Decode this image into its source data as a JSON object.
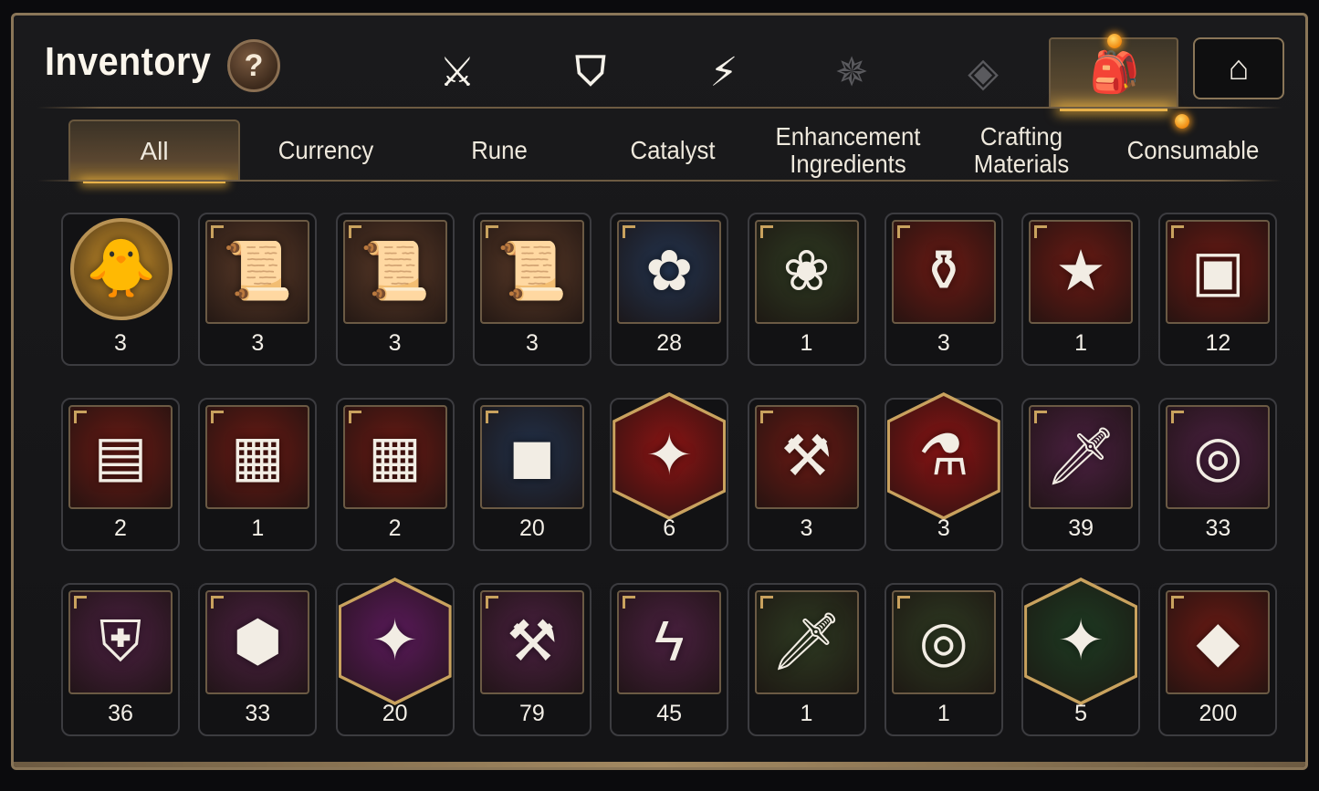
{
  "header": {
    "title": "Inventory",
    "help_label": "?"
  },
  "category_icons": [
    {
      "name": "equipment-icon",
      "glyph": "⚔"
    },
    {
      "name": "broken-shield-icon",
      "glyph": "⛉"
    },
    {
      "name": "lightning-icon",
      "glyph": "⚡"
    },
    {
      "name": "rune-burst-icon",
      "glyph": "✵"
    },
    {
      "name": "cube-icon",
      "glyph": "◈"
    },
    {
      "name": "backpack-icon",
      "glyph": "🎒",
      "active": true
    },
    {
      "name": "storage-house-icon",
      "glyph": "⌂"
    }
  ],
  "tabs": [
    {
      "label": "All",
      "active": true
    },
    {
      "label": "Currency"
    },
    {
      "label": "Rune"
    },
    {
      "label": "Catalyst"
    },
    {
      "label": "Enhancement",
      "label2": "Ingredients"
    },
    {
      "label": "Crafting",
      "label2": "Materials"
    },
    {
      "label": "Consumable",
      "notify": true
    }
  ],
  "items": [
    {
      "icon": "hero-portrait-icon",
      "glyph": "🐥",
      "count": "3",
      "bg": "#d79a2c",
      "shape": "round"
    },
    {
      "icon": "upgrade-scroll-icon",
      "glyph": "📜",
      "count": "3",
      "bg": "#5a3a28"
    },
    {
      "icon": "rainbow-scroll-icon",
      "glyph": "📜",
      "count": "3",
      "bg": "#5a3a28"
    },
    {
      "icon": "upgrade-scroll-icon",
      "glyph": "📜",
      "count": "3",
      "bg": "#5a3a28"
    },
    {
      "icon": "gold-flower-icon",
      "glyph": "✿",
      "count": "28",
      "bg": "#23344f"
    },
    {
      "icon": "silver-flower-icon",
      "glyph": "❀",
      "count": "1",
      "bg": "#2e3a22"
    },
    {
      "icon": "red-potion-icon",
      "glyph": "⚱",
      "count": "3",
      "bg": "#6a1a14"
    },
    {
      "icon": "star-potion-icon",
      "glyph": "★",
      "count": "1",
      "bg": "#6a1a14"
    },
    {
      "icon": "silver-chest-icon",
      "glyph": "▣",
      "count": "12",
      "bg": "#6a1a14"
    },
    {
      "icon": "blue-chest-icon",
      "glyph": "▤",
      "count": "2",
      "bg": "#6a1a14"
    },
    {
      "icon": "gold-chest-icon",
      "glyph": "▦",
      "count": "1",
      "bg": "#6a1a14"
    },
    {
      "icon": "gold-chest-icon",
      "glyph": "▦",
      "count": "2",
      "bg": "#6a1a14"
    },
    {
      "icon": "steel-box-icon",
      "glyph": "◼",
      "count": "20",
      "bg": "#22314a"
    },
    {
      "icon": "red-star-gem-icon",
      "glyph": "✦",
      "count": "6",
      "bg": "#8a1414",
      "shape": "hex"
    },
    {
      "icon": "red-hammer-gem-icon",
      "glyph": "⚒",
      "count": "3",
      "bg": "#6a1a14"
    },
    {
      "icon": "pink-potion-icon",
      "glyph": "⚗",
      "count": "3",
      "bg": "#8a1414",
      "shape": "hex"
    },
    {
      "icon": "sword-rune-icon",
      "glyph": "🗡",
      "count": "39",
      "bg": "#4a2040"
    },
    {
      "icon": "spiral-rune-icon",
      "glyph": "◎",
      "count": "33",
      "bg": "#4a2040"
    },
    {
      "icon": "armor-rune-icon",
      "glyph": "⛨",
      "count": "36",
      "bg": "#4a2040"
    },
    {
      "icon": "boot-rune-icon",
      "glyph": "⬢",
      "count": "33",
      "bg": "#4a2040"
    },
    {
      "icon": "star-rune-icon",
      "glyph": "✦",
      "count": "20",
      "bg": "#5a1a5a",
      "shape": "hex"
    },
    {
      "icon": "hammer-rune-icon",
      "glyph": "⚒",
      "count": "79",
      "bg": "#4a2040"
    },
    {
      "icon": "bolt-rune-icon",
      "glyph": "ϟ",
      "count": "45",
      "bg": "#4a2040"
    },
    {
      "icon": "stone-sword-rune-icon",
      "glyph": "🗡",
      "count": "1",
      "bg": "#2e3a22"
    },
    {
      "icon": "stone-spiral-rune-icon",
      "glyph": "◎",
      "count": "1",
      "bg": "#2e3a22"
    },
    {
      "icon": "stone-star-rune-icon",
      "glyph": "✦",
      "count": "5",
      "bg": "#1e3a22",
      "shape": "hex"
    },
    {
      "icon": "ember-crystal-icon",
      "glyph": "◆",
      "count": "200",
      "bg": "#6a1a14"
    }
  ],
  "colors": {
    "frame_border": "#8a7658",
    "accent_gold": "#e8b24a",
    "panel_bg": "#1a1a1c"
  }
}
